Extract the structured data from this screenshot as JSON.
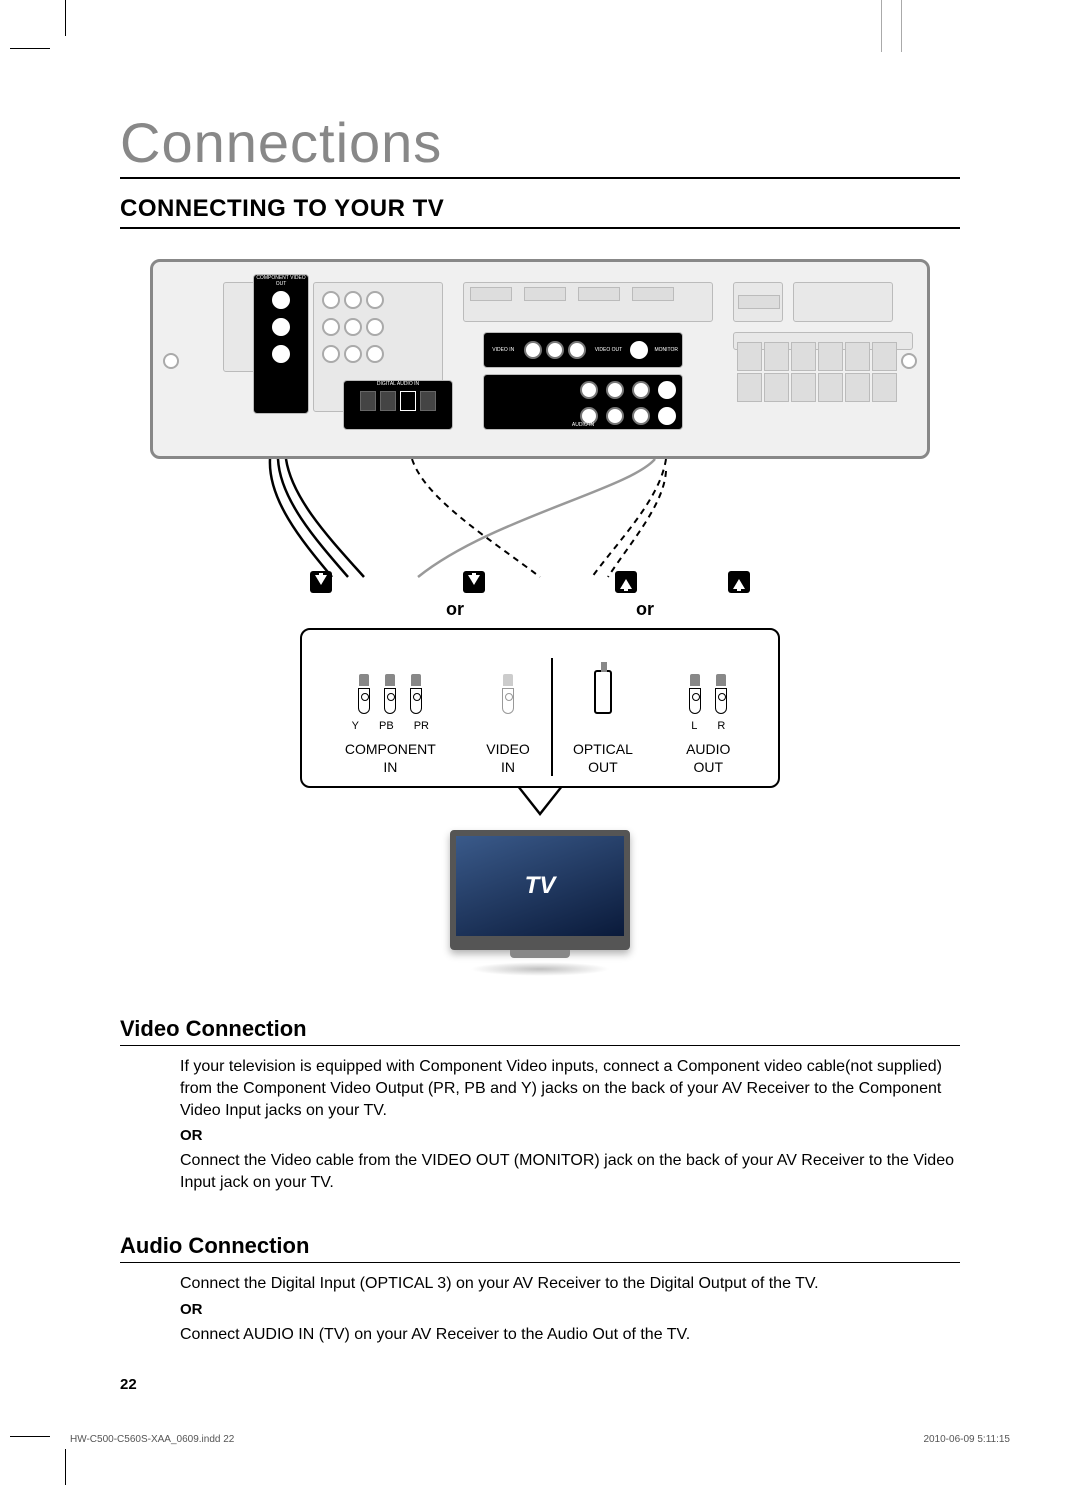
{
  "page": {
    "title": "Connections",
    "section": "CONNECTING TO YOUR TV",
    "number": "22"
  },
  "diagram": {
    "or1": "or",
    "or2": "or",
    "tv_label": "TV",
    "receiver_labels": {
      "component_out": "COMPONENT VIDEO OUT",
      "monitor": "MONITOR",
      "digital_audio_in": "DIGITAL AUDIO IN",
      "video_in": "VIDEO IN",
      "video_out": "VIDEO OUT",
      "audio_in": "AUDIO IN"
    },
    "tv_ports": {
      "component": {
        "y": "Y",
        "pb": "PB",
        "pr": "PR",
        "label_top": "COMPONENT",
        "label_bot": "IN"
      },
      "video": {
        "label_top": "VIDEO",
        "label_bot": "IN"
      },
      "optical": {
        "label_top": "OPTICAL",
        "label_bot": "OUT"
      },
      "audio": {
        "l": "L",
        "r": "R",
        "label_top": "AUDIO",
        "label_bot": "OUT"
      }
    }
  },
  "video_section": {
    "heading": "Video Connection",
    "p1": "If your television is equipped with Component Video inputs, connect a Component video cable(not supplied) from the Component Video Output (PR, PB and Y) jacks on the back of your AV Receiver to the Component Video Input jacks on your TV.",
    "or": "OR",
    "p2": "Connect the Video cable from the VIDEO OUT (MONITOR) jack on the back of your AV Receiver to the Video Input jack on your TV."
  },
  "audio_section": {
    "heading": "Audio Connection",
    "p1": "Connect the Digital Input (OPTICAL 3) on your AV Receiver to the Digital Output of the TV.",
    "or": "OR",
    "p2": "Connect AUDIO IN (TV) on your AV Receiver to the Audio Out of the TV."
  },
  "footer": {
    "left": "HW-C500-C560S-XAA_0609.indd   22",
    "right": "2010-06-09   5:11:15"
  }
}
